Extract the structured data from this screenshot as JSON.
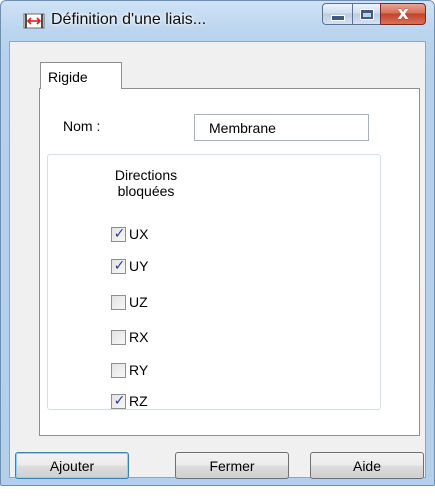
{
  "window": {
    "title": "Définition d'une liais...",
    "icon": "link-definition-icon",
    "controls": {
      "close_glyph": "x"
    }
  },
  "tabs": [
    {
      "label": "Rigide",
      "selected": true
    }
  ],
  "form": {
    "name_label": "Nom :",
    "name_value": "Membrane"
  },
  "directions": {
    "title": "Directions bloquées",
    "items": [
      {
        "label": "UX",
        "checked": true
      },
      {
        "label": "UY",
        "checked": true
      },
      {
        "label": "UZ",
        "checked": false
      },
      {
        "label": "RX",
        "checked": false
      },
      {
        "label": "RY",
        "checked": false
      },
      {
        "label": "RZ",
        "checked": true
      }
    ]
  },
  "buttons": {
    "add": "Ajouter",
    "close": "Fermer",
    "help": "Aide"
  },
  "colors": {
    "frame": "#b7d1ec",
    "close_button": "#c2432a",
    "check": "#2a3f8f"
  }
}
